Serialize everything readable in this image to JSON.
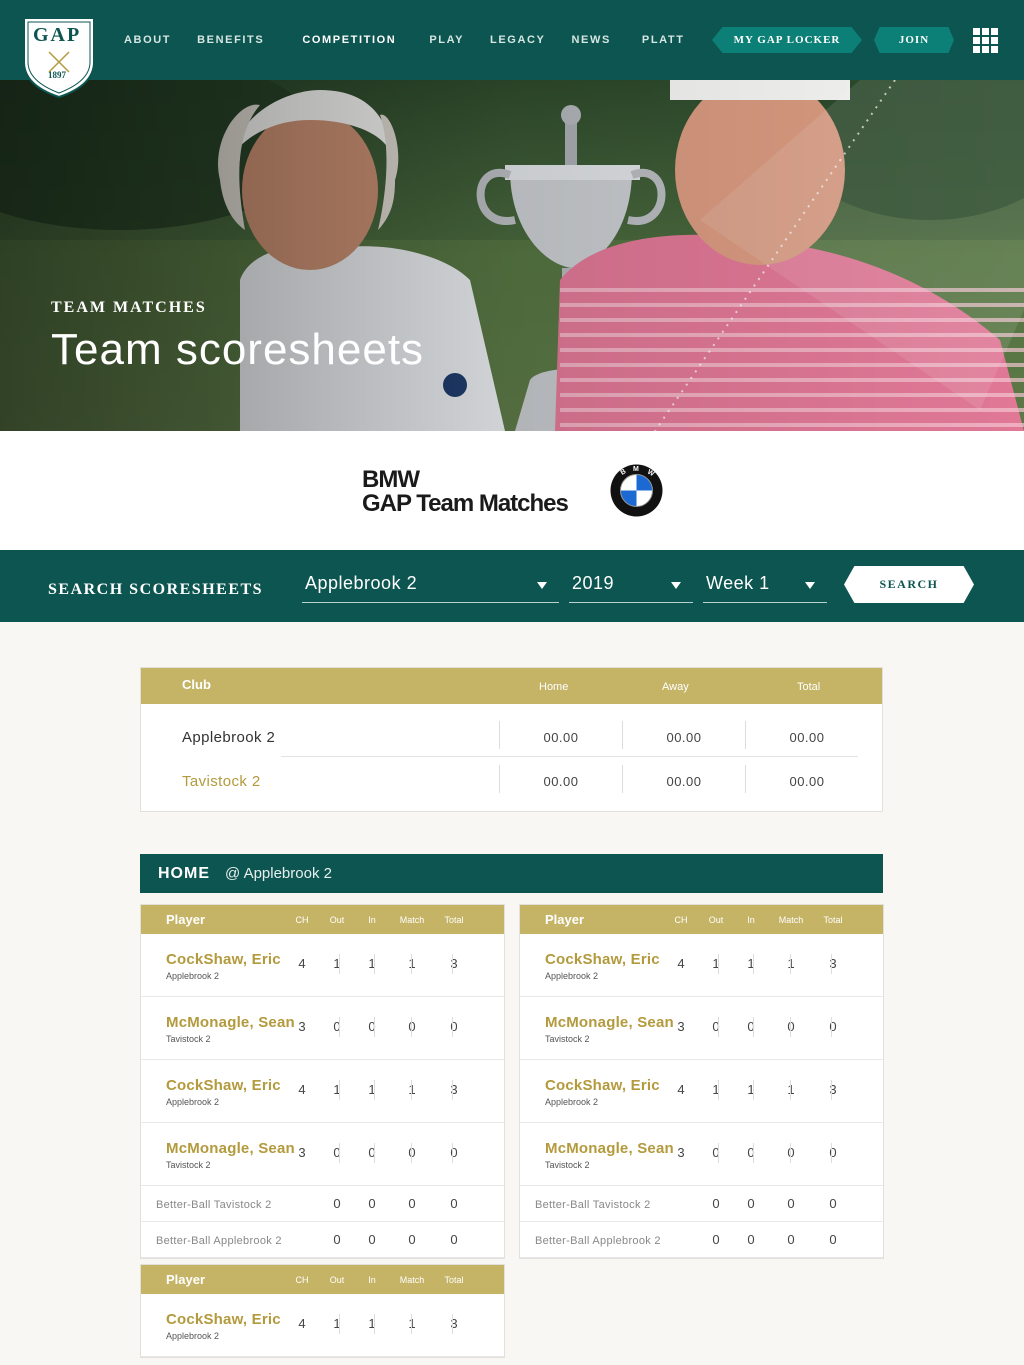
{
  "header": {
    "logo": {
      "text": "GAP",
      "year": "1897"
    },
    "nav": [
      "ABOUT",
      "BENEFITS",
      "COMPETITION",
      "PLAY",
      "LEGACY",
      "NEWS",
      "PLATT"
    ],
    "active_nav": "COMPETITION",
    "locker_label": "MY GAP LOCKER",
    "join_label": "JOIN",
    "menu_icon": "grid-menu-icon"
  },
  "hero": {
    "eyebrow": "TEAM MATCHES",
    "title": "Team scoresheets"
  },
  "sponsor": {
    "line1": "BMW",
    "line2": "GAP Team Matches",
    "logo_letters": "BMW"
  },
  "search": {
    "label": "SEARCH SCORESHEETS",
    "club": "Applebrook 2",
    "year": "2019",
    "week": "Week 1",
    "button": "SEARCH"
  },
  "summary": {
    "headers": {
      "club": "Club",
      "home": "Home",
      "away": "Away",
      "total": "Total"
    },
    "rows": [
      {
        "team": "Applebrook 2",
        "home": "00.00",
        "away": "00.00",
        "total": "00.00"
      },
      {
        "team": "Tavistock 2",
        "home": "00.00",
        "away": "00.00",
        "total": "00.00"
      }
    ]
  },
  "section": {
    "label": "HOME",
    "venue": "@ Applebrook 2"
  },
  "card_headers": {
    "player": "Player",
    "ch": "CH",
    "out": "Out",
    "in": "In",
    "match": "Match",
    "total": "Total"
  },
  "cards": [
    {
      "players": [
        {
          "name": "CockShaw, Eric",
          "club": "Applebrook 2",
          "ch": "4",
          "out": "1",
          "in": "1",
          "match": "1",
          "total": "3"
        },
        {
          "name": "McMonagle, Sean",
          "club": "Tavistock 2",
          "ch": "3",
          "out": "0",
          "in": "0",
          "match": "0",
          "total": "0"
        },
        {
          "name": "CockShaw, Eric",
          "club": "Applebrook 2",
          "ch": "4",
          "out": "1",
          "in": "1",
          "match": "1",
          "total": "3"
        },
        {
          "name": "McMonagle, Sean",
          "club": "Tavistock 2",
          "ch": "3",
          "out": "0",
          "in": "0",
          "match": "0",
          "total": "0"
        }
      ],
      "betterball": [
        {
          "label": "Better-Ball  Tavistock 2",
          "out": "0",
          "in": "0",
          "match": "0",
          "total": "0"
        },
        {
          "label": "Better-Ball  Applebrook 2",
          "out": "0",
          "in": "0",
          "match": "0",
          "total": "0"
        }
      ]
    },
    {
      "players": [
        {
          "name": "CockShaw, Eric",
          "club": "Applebrook 2",
          "ch": "4",
          "out": "1",
          "in": "1",
          "match": "1",
          "total": "3"
        },
        {
          "name": "McMonagle, Sean",
          "club": "Tavistock 2",
          "ch": "3",
          "out": "0",
          "in": "0",
          "match": "0",
          "total": "0"
        },
        {
          "name": "CockShaw, Eric",
          "club": "Applebrook 2",
          "ch": "4",
          "out": "1",
          "in": "1",
          "match": "1",
          "total": "3"
        },
        {
          "name": "McMonagle, Sean",
          "club": "Tavistock 2",
          "ch": "3",
          "out": "0",
          "in": "0",
          "match": "0",
          "total": "0"
        }
      ],
      "betterball": [
        {
          "label": "Better-Ball  Tavistock 2",
          "out": "0",
          "in": "0",
          "match": "0",
          "total": "0"
        },
        {
          "label": "Better-Ball  Applebrook 2",
          "out": "0",
          "in": "0",
          "match": "0",
          "total": "0"
        }
      ]
    },
    {
      "players": [
        {
          "name": "CockShaw, Eric",
          "club": "Applebrook 2",
          "ch": "4",
          "out": "1",
          "in": "1",
          "match": "1",
          "total": "3"
        }
      ],
      "betterball": []
    }
  ]
}
